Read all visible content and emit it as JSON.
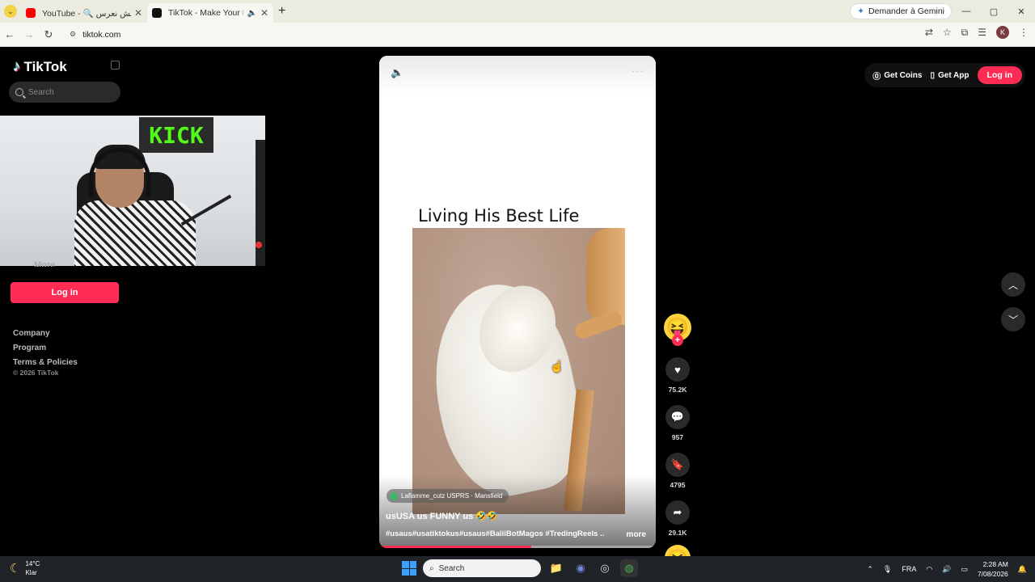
{
  "browser": {
    "tabs": [
      {
        "title": "YouTube - 🔍 أخيرا بش نعرس",
        "favicon_color": "#ff0000",
        "active": false
      },
      {
        "title": "TikTok - Make Your Day",
        "favicon_color": "#000000",
        "active": true
      }
    ],
    "gemini_label": "Demander à Gemini",
    "url": "tiktok.com"
  },
  "sidebar": {
    "logo_text": "TikTok",
    "search_placeholder": "Search",
    "webcam_sign": "KICK",
    "more_label": "More",
    "login_label": "Log in",
    "footer_links": [
      "Company",
      "Program",
      "Terms & Policies"
    ],
    "copyright": "© 2026 TikTok"
  },
  "header": {
    "get_coins": "Get Coins",
    "get_app": "Get App",
    "login": "Log in"
  },
  "video": {
    "caption": "Living His Best Life",
    "author": "Laflamme_cutz USPRS · Mansfield",
    "title": "usUSA us FUNNY us 🤣🤣",
    "tags": "#usaus#usatiktokus#usaus#BaliiBotMagos #TredingReels ...",
    "more": "more",
    "progress": 0.55
  },
  "actions": {
    "likes": "75.2K",
    "comments": "957",
    "saves": "4795",
    "shares": "29.1K"
  },
  "taskbar": {
    "temp": "14°C",
    "condition": "Klar",
    "search_label": "Search",
    "lang": "FRA",
    "time": "2:28 AM",
    "date": "7/08/2026"
  },
  "colors": {
    "accent": "#fe2c55",
    "background": "#000000"
  }
}
